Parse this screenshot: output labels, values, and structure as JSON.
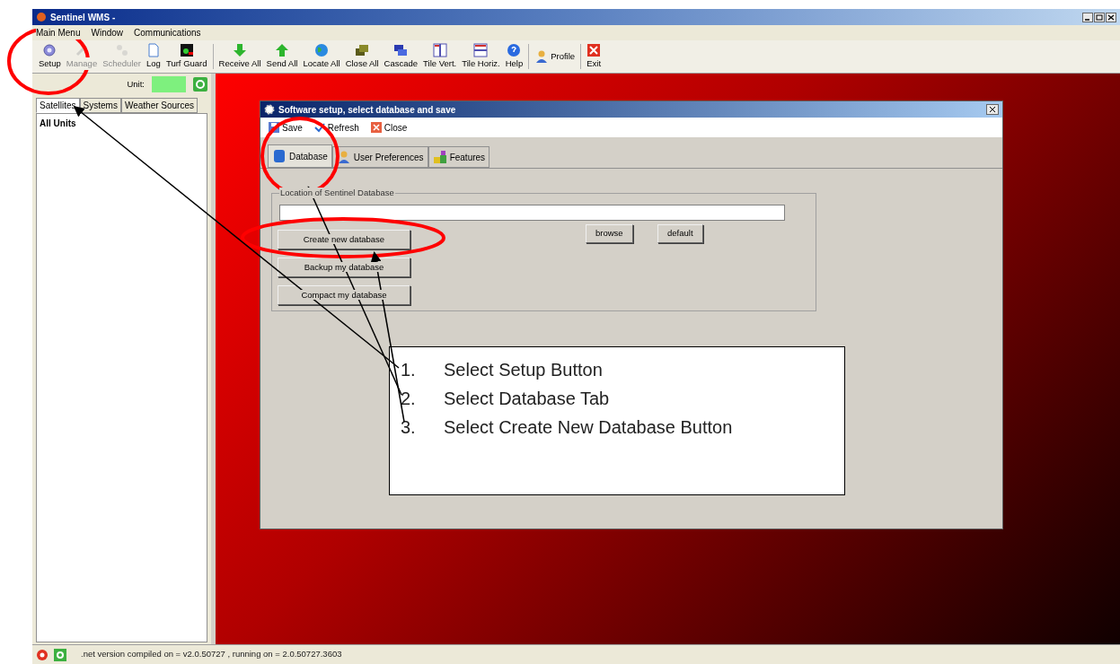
{
  "window": {
    "title": "Sentinel WMS -"
  },
  "menu": [
    "Main Menu",
    "Window",
    "Communications"
  ],
  "toolbar_groups": [
    {
      "items": [
        {
          "label": "Setup",
          "kind": "stacked",
          "disabled": false
        },
        {
          "label": "Manage",
          "kind": "stacked",
          "disabled": true
        },
        {
          "label": "Scheduler",
          "kind": "stacked",
          "disabled": true
        },
        {
          "label": "Log",
          "kind": "stacked",
          "disabled": false
        },
        {
          "label": "Turf Guard",
          "kind": "stacked",
          "disabled": false
        }
      ]
    },
    {
      "items": [
        {
          "label": "Receive All",
          "kind": "stacked",
          "disabled": false
        },
        {
          "label": "Send All",
          "kind": "stacked",
          "disabled": false
        },
        {
          "label": "Locate All",
          "kind": "stacked",
          "disabled": false
        },
        {
          "label": "Close All",
          "kind": "stacked",
          "disabled": false
        },
        {
          "label": "Cascade",
          "kind": "stacked",
          "disabled": false
        },
        {
          "label": "Tile Vert.",
          "kind": "stacked",
          "disabled": false
        },
        {
          "label": "Tile Horiz.",
          "kind": "stacked",
          "disabled": false
        },
        {
          "label": "Help",
          "kind": "stacked",
          "disabled": false
        }
      ]
    },
    {
      "items": [
        {
          "label": "Profile",
          "kind": "inline",
          "disabled": false
        }
      ]
    },
    {
      "items": [
        {
          "label": "Exit",
          "kind": "stacked",
          "disabled": false
        }
      ]
    }
  ],
  "sidebar": {
    "unit_label": "Unit:",
    "tabs": [
      {
        "label": "Satellites",
        "selected": true
      },
      {
        "label": "Systems",
        "selected": false
      },
      {
        "label": "Weather Sources",
        "selected": false
      }
    ],
    "tree": [
      {
        "label": "All Units"
      }
    ]
  },
  "dialog": {
    "title": "Software setup, select database and save",
    "toolbar": [
      "Save",
      "Refresh",
      "Close"
    ],
    "tabs": [
      {
        "label": "Database",
        "selected": true
      },
      {
        "label": "User Preferences",
        "selected": false
      },
      {
        "label": "Features",
        "selected": false
      }
    ],
    "group_label": "Location of Sentinel Database",
    "side_buttons": [
      "browse",
      "default"
    ],
    "buttons": [
      "Create new database",
      "Backup my database",
      "Compact my database"
    ]
  },
  "callout": {
    "steps": [
      {
        "number": "1.",
        "text": "Select Setup Button"
      },
      {
        "number": "2.",
        "text": "Select Database Tab"
      },
      {
        "number": "3.",
        "text": "Select Create New Database Button"
      }
    ]
  },
  "status_bar": {
    "text": ".net version compiled on = v2.0.50727 , running on = 2.0.50727.3603"
  }
}
